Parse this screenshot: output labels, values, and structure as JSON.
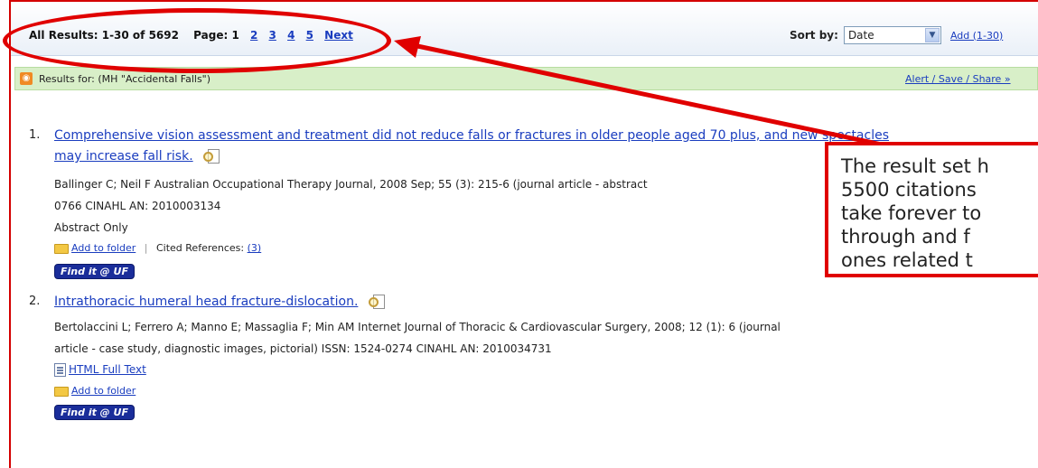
{
  "header": {
    "all_results": "All Results: 1-30 of 5692",
    "page_label": "Page: 1",
    "pages": [
      "2",
      "3",
      "4",
      "5",
      "Next"
    ],
    "sort_label": "Sort by:",
    "sort_value": "Date",
    "add_link": "Add (1-30)"
  },
  "results_bar": {
    "label": "Results for: (MH \"Accidental Falls\")",
    "alert_link": "Alert / Save / Share »",
    "icon": "rss-icon"
  },
  "results": [
    {
      "number": "1.",
      "title_line1": "Comprehensive vision assessment and treatment did not reduce falls or fractures in older people aged 70 plus, and new spectacles",
      "title_line2": "may increase fall risk.",
      "citation_line1": "Ballinger C; Neil F Australian Occupational Therapy Journal, 2008 Sep; 55 (3): 215-6 (journal article - abstract",
      "citation_line2": "0766 CINAHL AN: 2010003134",
      "availability": "Abstract Only",
      "add_to_folder": "Add to folder",
      "cited_refs_label": "Cited References:",
      "cited_refs_count": "(3)",
      "findit": "Find it @ UF"
    },
    {
      "number": "2.",
      "title_line1": "Intrathoracic humeral head fracture-dislocation.",
      "citation_line1": "Bertolaccini L; Ferrero A; Manno E; Massaglia F; Min AM Internet Journal of Thoracic & Cardiovascular Surgery, 2008; 12 (1): 6 (journal",
      "citation_line2": "article - case study, diagnostic images, pictorial) ISSN: 1524-0274 CINAHL AN: 2010034731",
      "fulltext": "HTML Full Text",
      "add_to_folder": "Add to folder",
      "findit": "Find it @ UF"
    }
  ],
  "annotation": {
    "lines": [
      "The result set h",
      "5500 citations",
      "take forever to",
      "through and f",
      "ones related t"
    ],
    "color": "#e00000"
  }
}
